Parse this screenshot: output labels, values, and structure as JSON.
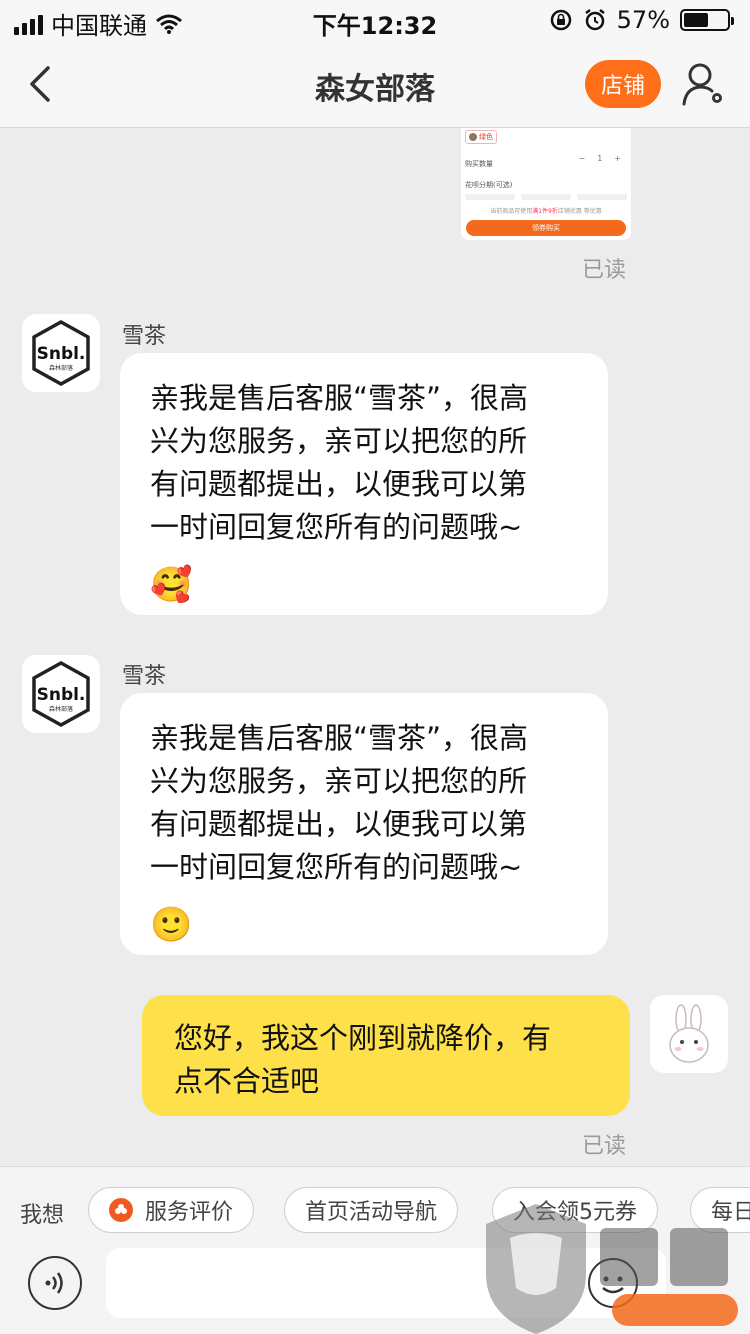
{
  "status_bar": {
    "carrier": "中国联通",
    "time": "下午12:32",
    "battery_percent": "57%",
    "battery_level": 0.57
  },
  "nav": {
    "title": "森女部落",
    "store_label": "店铺"
  },
  "product_card": {
    "variant_chip": "绿色",
    "quantity_label": "购买数量",
    "quantity_value": "1",
    "installment_label": "花呗分期(可选)",
    "promo_prefix": "当前商品可使用",
    "promo_highlight": "满1件9折",
    "promo_suffix": "店铺优惠 等优惠",
    "buy_label": "领券购买"
  },
  "messages": [
    {
      "read_label": "已读"
    },
    {
      "sender": "雪茶",
      "avatar_text": "Snbl.",
      "avatar_subtext": "森林部落",
      "text": "亲我是售后客服“雪茶”，很高\n兴为您服务，亲可以把您的所\n有问题都提出，以便我可以第\n一时间回复您所有的问题哦~",
      "emoji": "🥰"
    },
    {
      "sender": "雪茶",
      "avatar_text": "Snbl.",
      "avatar_subtext": "森林部落",
      "text": "亲我是售后客服“雪茶”，很高\n兴为您服务，亲可以把您的所\n有问题都提出，以便我可以第\n一时间回复您所有的问题哦~",
      "emoji": "🙂"
    },
    {
      "self": true,
      "text": "您好，我这个刚到就降价，有\n点不合适吧",
      "read_label": "已读"
    }
  ],
  "quick_bar": {
    "label": "我想",
    "chips": [
      "服务评价",
      "首页活动导航",
      "入会领5元券",
      "每日"
    ]
  },
  "colors": {
    "accent": "#ff6f1a",
    "self_bubble": "#fde04a",
    "background": "#ececec"
  }
}
